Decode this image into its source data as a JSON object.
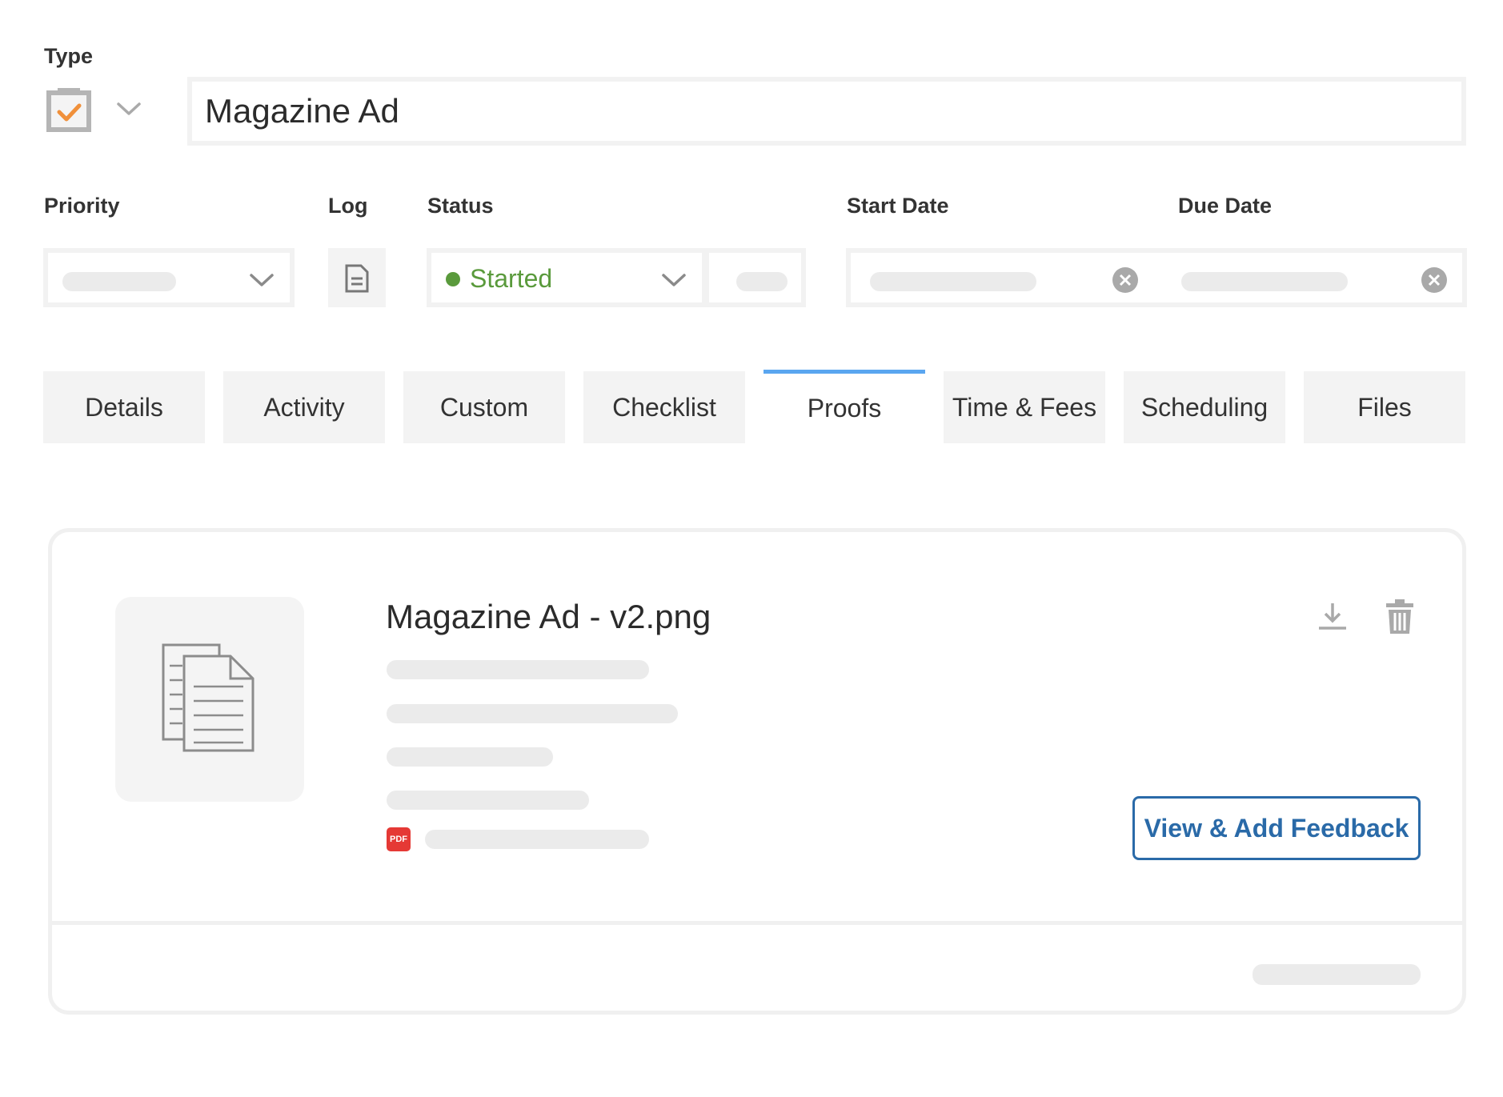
{
  "type_section": {
    "label": "Type",
    "icon": "checklist-clipboard-icon",
    "title_value": "Magazine Ad"
  },
  "fields": {
    "priority_label": "Priority",
    "log_label": "Log",
    "status_label": "Status",
    "status_value": "Started",
    "start_date_label": "Start Date",
    "due_date_label": "Due Date"
  },
  "tabs": [
    {
      "label": "Details"
    },
    {
      "label": "Activity"
    },
    {
      "label": "Custom"
    },
    {
      "label": "Checklist"
    },
    {
      "label": "Proofs"
    },
    {
      "label": "Time & Fees"
    },
    {
      "label": "Scheduling"
    },
    {
      "label": "Files"
    }
  ],
  "active_tab": "Proofs",
  "proof": {
    "file_name": "Magazine Ad - v2.png",
    "file_badge": "PDF",
    "feedback_button": "View & Add Feedback"
  },
  "colors": {
    "status_green": "#5a9a3c",
    "accent_blue": "#2a6aa8",
    "tab_underline": "#5aa6f0",
    "pdf_red": "#e53935",
    "check_orange": "#f0903a"
  }
}
